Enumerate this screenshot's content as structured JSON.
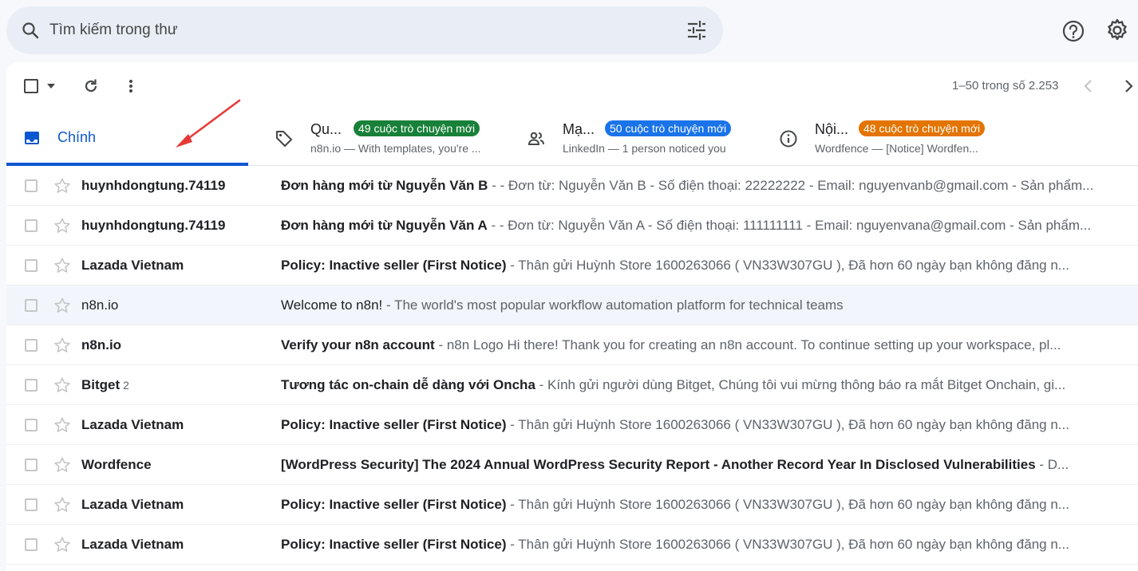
{
  "search": {
    "placeholder": "Tìm kiếm trong thư"
  },
  "toolbar": {
    "page_count": "1–50 trong số 2.253"
  },
  "tabs": [
    {
      "label": "Chính"
    },
    {
      "title": "Qu...",
      "badge": "49 cuộc trò chuyện mới",
      "badge_color": "#188038",
      "sub": "n8n.io — With templates, you're ..."
    },
    {
      "title": "Mạ...",
      "badge": "50 cuộc trò chuyện mới",
      "badge_color": "#1a73e8",
      "sub": "LinkedIn — 1 person noticed you"
    },
    {
      "title": "Nội...",
      "badge": "48 cuộc trò chuyện mới",
      "badge_color": "#e37400",
      "sub": "Wordfence — [Notice] Wordfen..."
    }
  ],
  "emails": [
    {
      "sender": "huynhdongtung.74119",
      "count": "",
      "subject": "Đơn hàng mới từ Nguyễn Văn B",
      "snippet": " - - Đơn từ: Nguyễn Văn B - Số điện thoại: 22222222 - Email: nguyenvanb@gmail.com - Sản phẩm..."
    },
    {
      "sender": "huynhdongtung.74119",
      "count": "",
      "subject": "Đơn hàng mới từ Nguyễn Văn A",
      "snippet": " - - Đơn từ: Nguyễn Văn A - Số điện thoại: 111111111 - Email: nguyenvana@gmail.com - Sản phẩm..."
    },
    {
      "sender": "Lazada Vietnam",
      "count": "",
      "subject": "Policy: Inactive seller (First Notice)",
      "snippet": " - Thân gửi Huỳnh Store 1600263066 ( VN33W307GU ), Đã hơn 60 ngày bạn không đăng n..."
    },
    {
      "sender": "n8n.io",
      "count": "",
      "subject": "Welcome to n8n!",
      "snippet": " - The world's most popular workflow automation platform for technical teams"
    },
    {
      "sender": "n8n.io",
      "count": "",
      "subject": "Verify your n8n account",
      "snippet": " - n8n Logo Hi there! Thank you for creating an n8n account. To continue setting up your workspace, pl..."
    },
    {
      "sender": "Bitget",
      "count": "2",
      "subject": "Tương tác on-chain dễ dàng với Oncha",
      "snippet": " - Kính gửi người dùng Bitget, Chúng tôi vui mừng thông báo ra mắt Bitget Onchain, gi..."
    },
    {
      "sender": "Lazada Vietnam",
      "count": "",
      "subject": "Policy: Inactive seller (First Notice)",
      "snippet": " - Thân gửi Huỳnh Store 1600263066 ( VN33W307GU ), Đã hơn 60 ngày bạn không đăng n..."
    },
    {
      "sender": "Wordfence",
      "count": "",
      "subject": "[WordPress Security] The 2024 Annual WordPress Security Report - Another Record Year In Disclosed Vulnerabilities",
      "snippet": " - D..."
    },
    {
      "sender": "Lazada Vietnam",
      "count": "",
      "subject": "Policy: Inactive seller (First Notice)",
      "snippet": " - Thân gửi Huỳnh Store 1600263066 ( VN33W307GU ), Đã hơn 60 ngày bạn không đăng n..."
    },
    {
      "sender": "Lazada Vietnam",
      "count": "",
      "subject": "Policy: Inactive seller (First Notice)",
      "snippet": " - Thân gửi Huỳnh Store 1600263066 ( VN33W307GU ), Đã hơn 60 ngày bạn không đăng n..."
    }
  ],
  "colors": {
    "accent": "#0b57d0",
    "annotation_arrow": "#e53935"
  }
}
